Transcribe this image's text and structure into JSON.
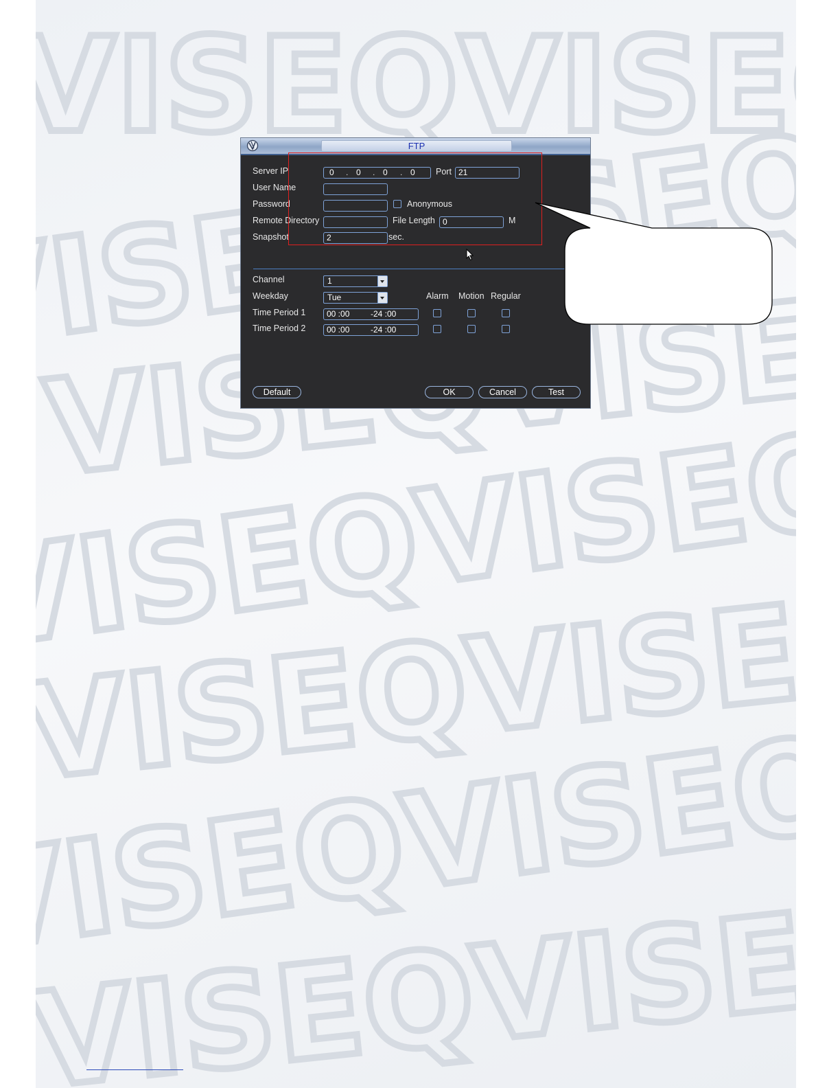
{
  "watermark": "VISEQVISEQ",
  "window": {
    "title": "FTP",
    "title_icon": "logo-icon"
  },
  "server": {
    "server_ip_label": "Server IP",
    "ip": [
      "0",
      "0",
      "0",
      "0"
    ],
    "port_label": "Port",
    "port_value": "21",
    "username_label": "User Name",
    "username_value": "",
    "password_label": "Password",
    "password_value": "",
    "anonymous_label": "Anonymous",
    "anonymous_checked": false,
    "remote_dir_label": "Remote Directory",
    "remote_dir_value": "",
    "file_length_label": "File Length",
    "file_length_value": "0",
    "file_length_unit": "M",
    "snapshot_label": "Snapshot",
    "snapshot_value": "2",
    "snapshot_unit": "sec."
  },
  "schedule": {
    "channel_label": "Channel",
    "channel_value": "1",
    "weekday_label": "Weekday",
    "weekday_value": "Tue",
    "col_alarm": "Alarm",
    "col_motion": "Motion",
    "col_regular": "Regular",
    "periods": [
      {
        "label": "Time Period 1",
        "start": "00 :00",
        "end": "-24 :00",
        "alarm": false,
        "motion": false,
        "regular": false
      },
      {
        "label": "Time Period 2",
        "start": "00 :00",
        "end": "-24 :00",
        "alarm": false,
        "motion": false,
        "regular": false
      }
    ]
  },
  "buttons": {
    "default": "Default",
    "ok": "OK",
    "cancel": "Cancel",
    "test": "Test"
  },
  "annotation": {
    "highlight_color": "#e0201f",
    "callout_text": ""
  }
}
